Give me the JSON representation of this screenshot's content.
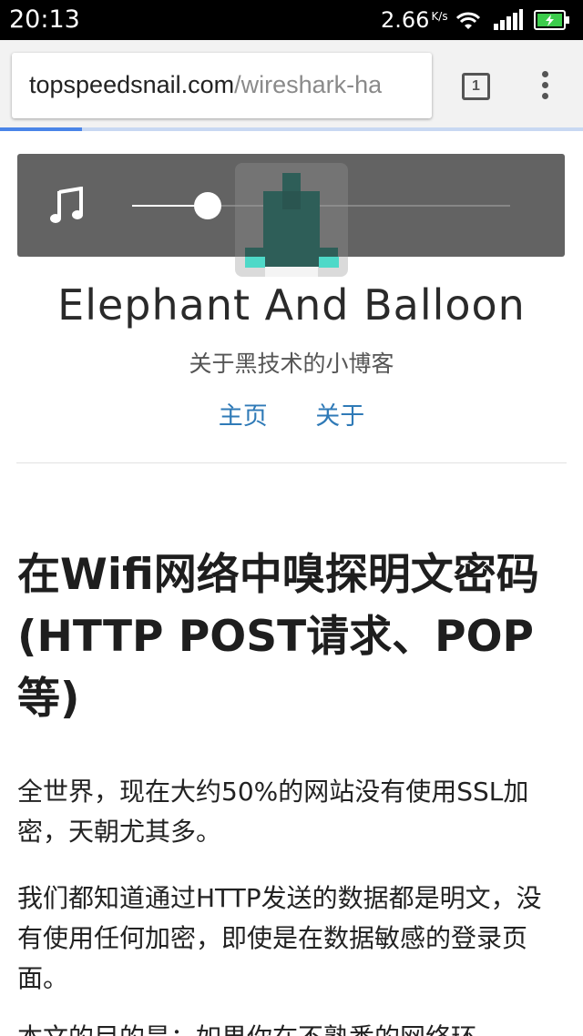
{
  "status_bar": {
    "time": "20:13",
    "speed": "2.66",
    "speed_unit": "K/s",
    "battery_color": "#3ccd4c"
  },
  "browser": {
    "url_host": "topspeedsnail.com",
    "url_path": "/wireshark-ha",
    "tab_count": "1",
    "load_progress": 0.14
  },
  "player": {
    "icon": "music-note-icon",
    "position": 0.2
  },
  "site": {
    "title": "Elephant And Balloon",
    "subtitle": "关于黑技术的小博客",
    "nav": [
      "主页",
      "关于"
    ],
    "link_color": "#2f7ab7"
  },
  "article": {
    "title": "在Wifi网络中嗅探明文密码(HTTP POST请求、POP等)",
    "paragraphs": [
      "全世界，现在大约50%的网站没有使用SSL加密，天朝尤其多。",
      "我们都知道通过HTTP发送的数据都是明文，没有使用任何加密，即使是在数据敏感的登录页面。",
      "本文的目的是：如果你在不熟悉的网络环"
    ]
  }
}
